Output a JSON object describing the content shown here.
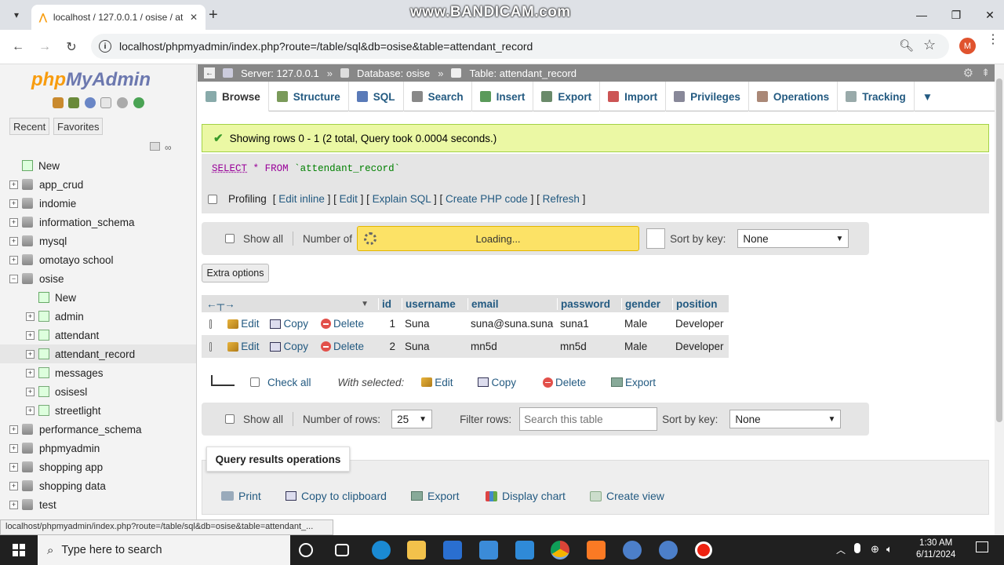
{
  "browser": {
    "tab_title": "localhost / 127.0.0.1 / osise / at",
    "url": "localhost/phpmyadmin/index.php?route=/table/sql&db=osise&table=attendant_record",
    "watermark": "www.BANDICAM.com",
    "profile_initial": "M"
  },
  "sidebar": {
    "logo_php": "php",
    "logo_myadmin": "MyAdmin",
    "recent": "Recent",
    "favorites": "Favorites",
    "tree": [
      {
        "label": "New",
        "level": 0,
        "kind": "new"
      },
      {
        "label": "app_crud",
        "level": 0,
        "kind": "db"
      },
      {
        "label": "indomie",
        "level": 0,
        "kind": "db"
      },
      {
        "label": "information_schema",
        "level": 0,
        "kind": "db"
      },
      {
        "label": "mysql",
        "level": 0,
        "kind": "db"
      },
      {
        "label": "omotayo school",
        "level": 0,
        "kind": "db"
      },
      {
        "label": "osise",
        "level": 0,
        "kind": "db-open"
      },
      {
        "label": "New",
        "level": 1,
        "kind": "new"
      },
      {
        "label": "admin",
        "level": 1,
        "kind": "table"
      },
      {
        "label": "attendant",
        "level": 1,
        "kind": "table"
      },
      {
        "label": "attendant_record",
        "level": 1,
        "kind": "table",
        "selected": true
      },
      {
        "label": "messages",
        "level": 1,
        "kind": "table"
      },
      {
        "label": "osisesl",
        "level": 1,
        "kind": "table"
      },
      {
        "label": "streetlight",
        "level": 1,
        "kind": "table"
      },
      {
        "label": "performance_schema",
        "level": 0,
        "kind": "db"
      },
      {
        "label": "phpmyadmin",
        "level": 0,
        "kind": "db"
      },
      {
        "label": "shopping app",
        "level": 0,
        "kind": "db"
      },
      {
        "label": "shopping data",
        "level": 0,
        "kind": "db"
      },
      {
        "label": "test",
        "level": 0,
        "kind": "db"
      }
    ],
    "status_url": "localhost/phpmyadmin/index.php?route=/table/sql&db=osise&table=attendant_..."
  },
  "breadcrumb": {
    "server": "Server: 127.0.0.1",
    "database": "Database: osise",
    "table": "Table: attendant_record"
  },
  "tabs": [
    "Browse",
    "Structure",
    "SQL",
    "Search",
    "Insert",
    "Export",
    "Import",
    "Privileges",
    "Operations",
    "Tracking"
  ],
  "notice": "Showing rows 0 - 1 (2 total, Query took 0.0004 seconds.)",
  "sql": {
    "select": "SELECT",
    "star": "*",
    "from": "FROM",
    "table": "`attendant_record`"
  },
  "profiling": {
    "label": "Profiling",
    "links": [
      "Edit inline",
      "Edit",
      "Explain SQL",
      "Create PHP code",
      "Refresh"
    ]
  },
  "nav_top": {
    "show_all": "Show all",
    "number_of": "Number of",
    "loading": "Loading...",
    "sort_by_key": "Sort by key:",
    "sort_value": "None"
  },
  "extra_options": "Extra options",
  "table": {
    "columns": [
      "id",
      "username",
      "email",
      "password",
      "gender",
      "position"
    ],
    "rows": [
      {
        "id": "1",
        "username": "Suna",
        "email": "suna@suna.suna",
        "password": "suna1",
        "gender": "Male",
        "position": "Developer"
      },
      {
        "id": "2",
        "username": "Suna",
        "email": "mn5d",
        "password": "mn5d",
        "gender": "Male",
        "position": "Developer"
      }
    ],
    "actions": {
      "edit": "Edit",
      "copy": "Copy",
      "delete": "Delete"
    }
  },
  "with_selected": {
    "check_all": "Check all",
    "label": "With selected:",
    "edit": "Edit",
    "copy": "Copy",
    "delete": "Delete",
    "export": "Export"
  },
  "nav_bottom": {
    "show_all": "Show all",
    "number_of_rows": "Number of rows:",
    "rows_value": "25",
    "filter_rows": "Filter rows:",
    "filter_placeholder": "Search this table",
    "sort_by_key": "Sort by key:",
    "sort_value": "None"
  },
  "query_ops": {
    "title": "Query results operations",
    "print": "Print",
    "copy_clipboard": "Copy to clipboard",
    "export": "Export",
    "display_chart": "Display chart",
    "create_view": "Create view"
  },
  "taskbar": {
    "search_placeholder": "Type here to search",
    "time": "1:30 AM",
    "date": "6/11/2024"
  }
}
